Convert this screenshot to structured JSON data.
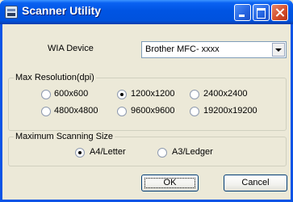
{
  "window": {
    "title": "Scanner Utility"
  },
  "wia": {
    "label": "WIA Device",
    "selected": "Brother MFC- xxxx"
  },
  "resolution": {
    "title": "Max Resolution(dpi)",
    "options": [
      "600x600",
      "1200x1200",
      "2400x2400",
      "4800x4800",
      "9600x9600",
      "19200x19200"
    ],
    "selected": "1200x1200"
  },
  "size": {
    "title": "Maximum Scanning Size",
    "options": [
      "A4/Letter",
      "A3/Ledger"
    ],
    "selected": "A4/Letter"
  },
  "buttons": {
    "ok": "OK",
    "cancel": "Cancel"
  }
}
